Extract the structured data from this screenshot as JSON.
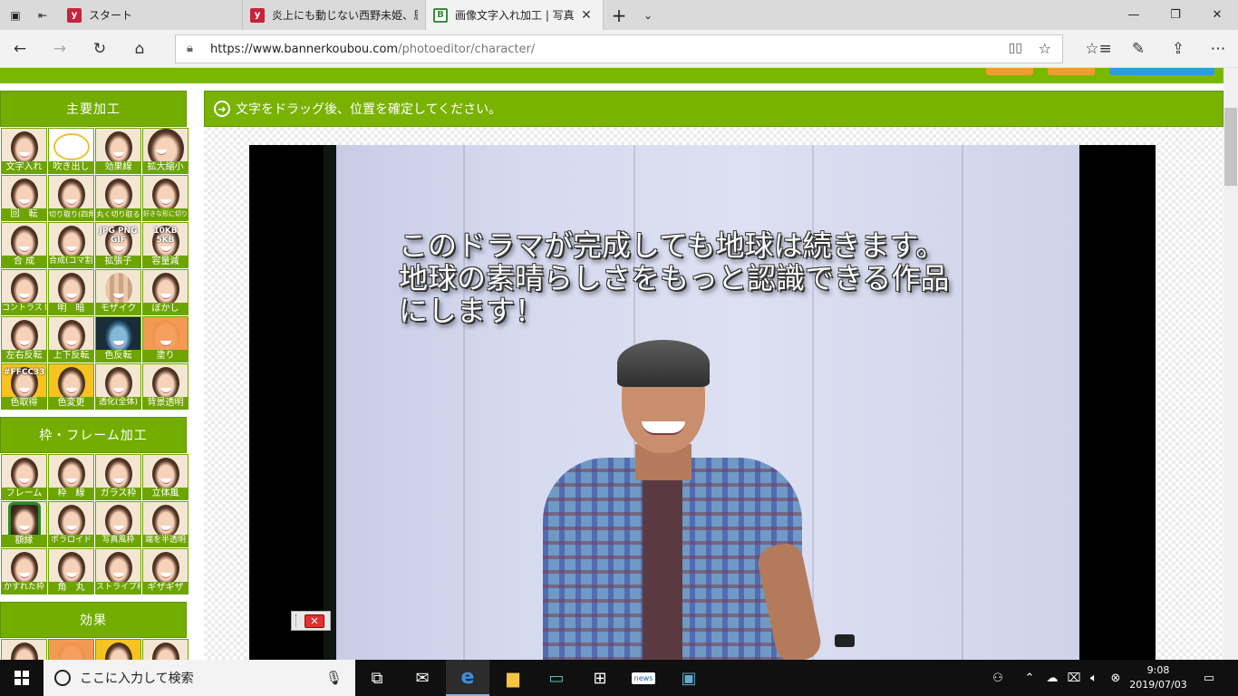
{
  "browser": {
    "tabs": [
      {
        "title": "スタート",
        "favicon": "y"
      },
      {
        "title": "炎上にも動じない西野未姫、恩",
        "favicon": "y"
      },
      {
        "title": "画像文字入れ加工 | 写真",
        "favicon": "B"
      }
    ],
    "url_host": "https://www.bannerkoubou.com",
    "url_path": "/photoeditor/character/"
  },
  "sidebar": {
    "sections": [
      {
        "title": "主要加工",
        "items": [
          "文字入れ",
          "吹き出し",
          "効果線",
          "拡大縮小",
          "回　転",
          "切り取り(四角)",
          "丸く切り取る",
          "好きな形に切り取る",
          "合 成",
          "合成(コマ割)",
          "拡張子",
          "容量減",
          "コントラスト",
          "明　暗",
          "モザイク",
          "ぼかし",
          "左右反転",
          "上下反転",
          "色反転",
          "塗り",
          "色取得",
          "色変更",
          "透化(全体)",
          "背景透明"
        ]
      },
      {
        "title": "枠・フレーム加工",
        "items": [
          "フレーム",
          "枠　線",
          "ガラス枠",
          "立体風",
          "額縁",
          "ポラロイド",
          "写真風枠",
          "端を半透明",
          "かすれた枠",
          "角　丸",
          "ストライプ枠",
          "ギザギザ"
        ]
      },
      {
        "title": "効果",
        "items": []
      }
    ],
    "overlays": {
      "ext": "JPG PNG GIF",
      "size": "10KB 5KB",
      "color_code": "#FFCC33"
    }
  },
  "editor": {
    "instruction": "文字をドラッグ後、位置を確定してください。",
    "overlay_text": "このドラマが完成しても地球は続きます。\n地球の素晴らしさをもっと認識できる作品\nにします！"
  },
  "taskbar": {
    "search_placeholder": "ここに入力して検索",
    "time": "9:08",
    "date": "2019/07/03",
    "news_label": "news"
  }
}
